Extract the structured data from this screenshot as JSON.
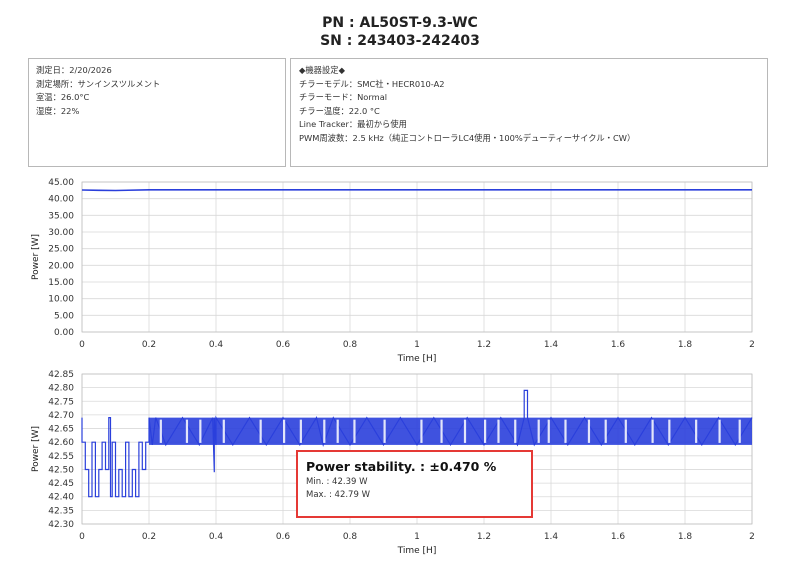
{
  "header": {
    "pn": "PN : AL50ST-9.3-WC",
    "sn": "SN : 243403-242403"
  },
  "info_left": [
    "測定日：2/20/2026",
    "測定場所：サンインスツルメント",
    "室温：26.0°C",
    "湿度：22%"
  ],
  "info_right": [
    "◆機器設定◆",
    "チラーモデル：SMC社・HECR010-A2",
    "チラーモード：Normal",
    "チラー温度：22.0 °C",
    "Line Tracker：最初から使用",
    "PWM周波数：2.5 kHz（純正コントローラLC4使用・100%デューティーサイクル・CW）"
  ],
  "stability": {
    "title": "Power stability. : ±0.470 %",
    "min": "Min. : 42.39 W",
    "max": "Max. : 42.79 W"
  },
  "colors": {
    "series": "#2a3fdb",
    "grid": "#d9d9d9",
    "axis": "#bfbfbf",
    "highlight": "#e53935"
  },
  "chart_data": [
    {
      "type": "line",
      "title": "",
      "xlabel": "Time [H]",
      "ylabel": "Power [W]",
      "xlim": [
        0,
        2
      ],
      "ylim": [
        0,
        45
      ],
      "x_ticks": [
        "0",
        "0.2",
        "0.4",
        "0.6",
        "0.8",
        "1",
        "1.2",
        "1.4",
        "1.6",
        "1.8",
        "2"
      ],
      "y_ticks": [
        "0.00",
        "5.00",
        "10.00",
        "15.00",
        "20.00",
        "25.00",
        "30.00",
        "35.00",
        "40.00",
        "45.00"
      ],
      "grid": true,
      "series": [
        {
          "x": [
            0,
            0.05,
            0.1,
            0.2,
            0.4,
            0.6,
            0.8,
            1.0,
            1.2,
            1.4,
            1.6,
            1.8,
            2.0
          ],
          "y": [
            42.6,
            42.5,
            42.45,
            42.65,
            42.67,
            42.67,
            42.67,
            42.67,
            42.67,
            42.67,
            42.67,
            42.67,
            42.67
          ]
        }
      ]
    },
    {
      "type": "line",
      "title": "",
      "xlabel": "Time [H]",
      "ylabel": "Power [W]",
      "xlim": [
        0,
        2
      ],
      "ylim": [
        42.3,
        42.85
      ],
      "x_ticks": [
        "0",
        "0.2",
        "0.4",
        "0.6",
        "0.8",
        "1",
        "1.2",
        "1.4",
        "1.6",
        "1.8",
        "2"
      ],
      "y_ticks": [
        "42.30",
        "42.35",
        "42.40",
        "42.45",
        "42.50",
        "42.55",
        "42.60",
        "42.65",
        "42.70",
        "42.75",
        "42.80",
        "42.85"
      ],
      "grid": true,
      "series": [
        {
          "x": [
            0,
            0.0,
            0.01,
            0.01,
            0.02,
            0.02,
            0.03,
            0.03,
            0.04,
            0.04,
            0.05,
            0.05,
            0.06,
            0.06,
            0.07,
            0.07,
            0.08,
            0.08,
            0.085,
            0.085,
            0.09,
            0.09,
            0.1,
            0.1,
            0.11,
            0.11,
            0.12,
            0.12,
            0.13,
            0.13,
            0.14,
            0.14,
            0.15,
            0.15,
            0.16,
            0.16,
            0.17,
            0.17,
            0.18,
            0.18,
            0.19,
            0.19,
            0.2,
            0.2,
            0.21,
            0.22,
            0.25,
            0.3,
            0.35,
            0.39,
            0.395,
            0.395,
            0.4,
            0.4,
            0.45,
            0.5,
            0.55,
            0.6,
            0.65,
            0.7,
            0.72,
            0.75,
            0.8,
            0.85,
            0.9,
            0.95,
            1.0,
            1.05,
            1.1,
            1.15,
            1.2,
            1.25,
            1.3,
            1.32,
            1.32,
            1.33,
            1.33,
            1.35,
            1.4,
            1.45,
            1.5,
            1.55,
            1.6,
            1.65,
            1.7,
            1.75,
            1.8,
            1.85,
            1.9,
            1.95,
            2.0
          ],
          "y": [
            42.69,
            42.6,
            42.6,
            42.5,
            42.5,
            42.4,
            42.4,
            42.6,
            42.6,
            42.4,
            42.4,
            42.5,
            42.5,
            42.6,
            42.6,
            42.5,
            42.5,
            42.69,
            42.69,
            42.4,
            42.4,
            42.6,
            42.6,
            42.4,
            42.4,
            42.5,
            42.5,
            42.4,
            42.4,
            42.6,
            42.6,
            42.4,
            42.4,
            42.5,
            42.5,
            42.4,
            42.4,
            42.6,
            42.6,
            42.5,
            42.5,
            42.6,
            42.6,
            42.69,
            42.59,
            42.69,
            42.59,
            42.69,
            42.59,
            42.69,
            42.49,
            42.69,
            42.59,
            42.69,
            42.59,
            42.69,
            42.59,
            42.69,
            42.59,
            42.69,
            42.59,
            42.69,
            42.59,
            42.69,
            42.59,
            42.69,
            42.59,
            42.69,
            42.59,
            42.69,
            42.59,
            42.69,
            42.59,
            42.69,
            42.79,
            42.79,
            42.69,
            42.59,
            42.69,
            42.59,
            42.69,
            42.59,
            42.69,
            42.59,
            42.69,
            42.59,
            42.69,
            42.59,
            42.69,
            42.59,
            42.69
          ]
        }
      ]
    }
  ]
}
